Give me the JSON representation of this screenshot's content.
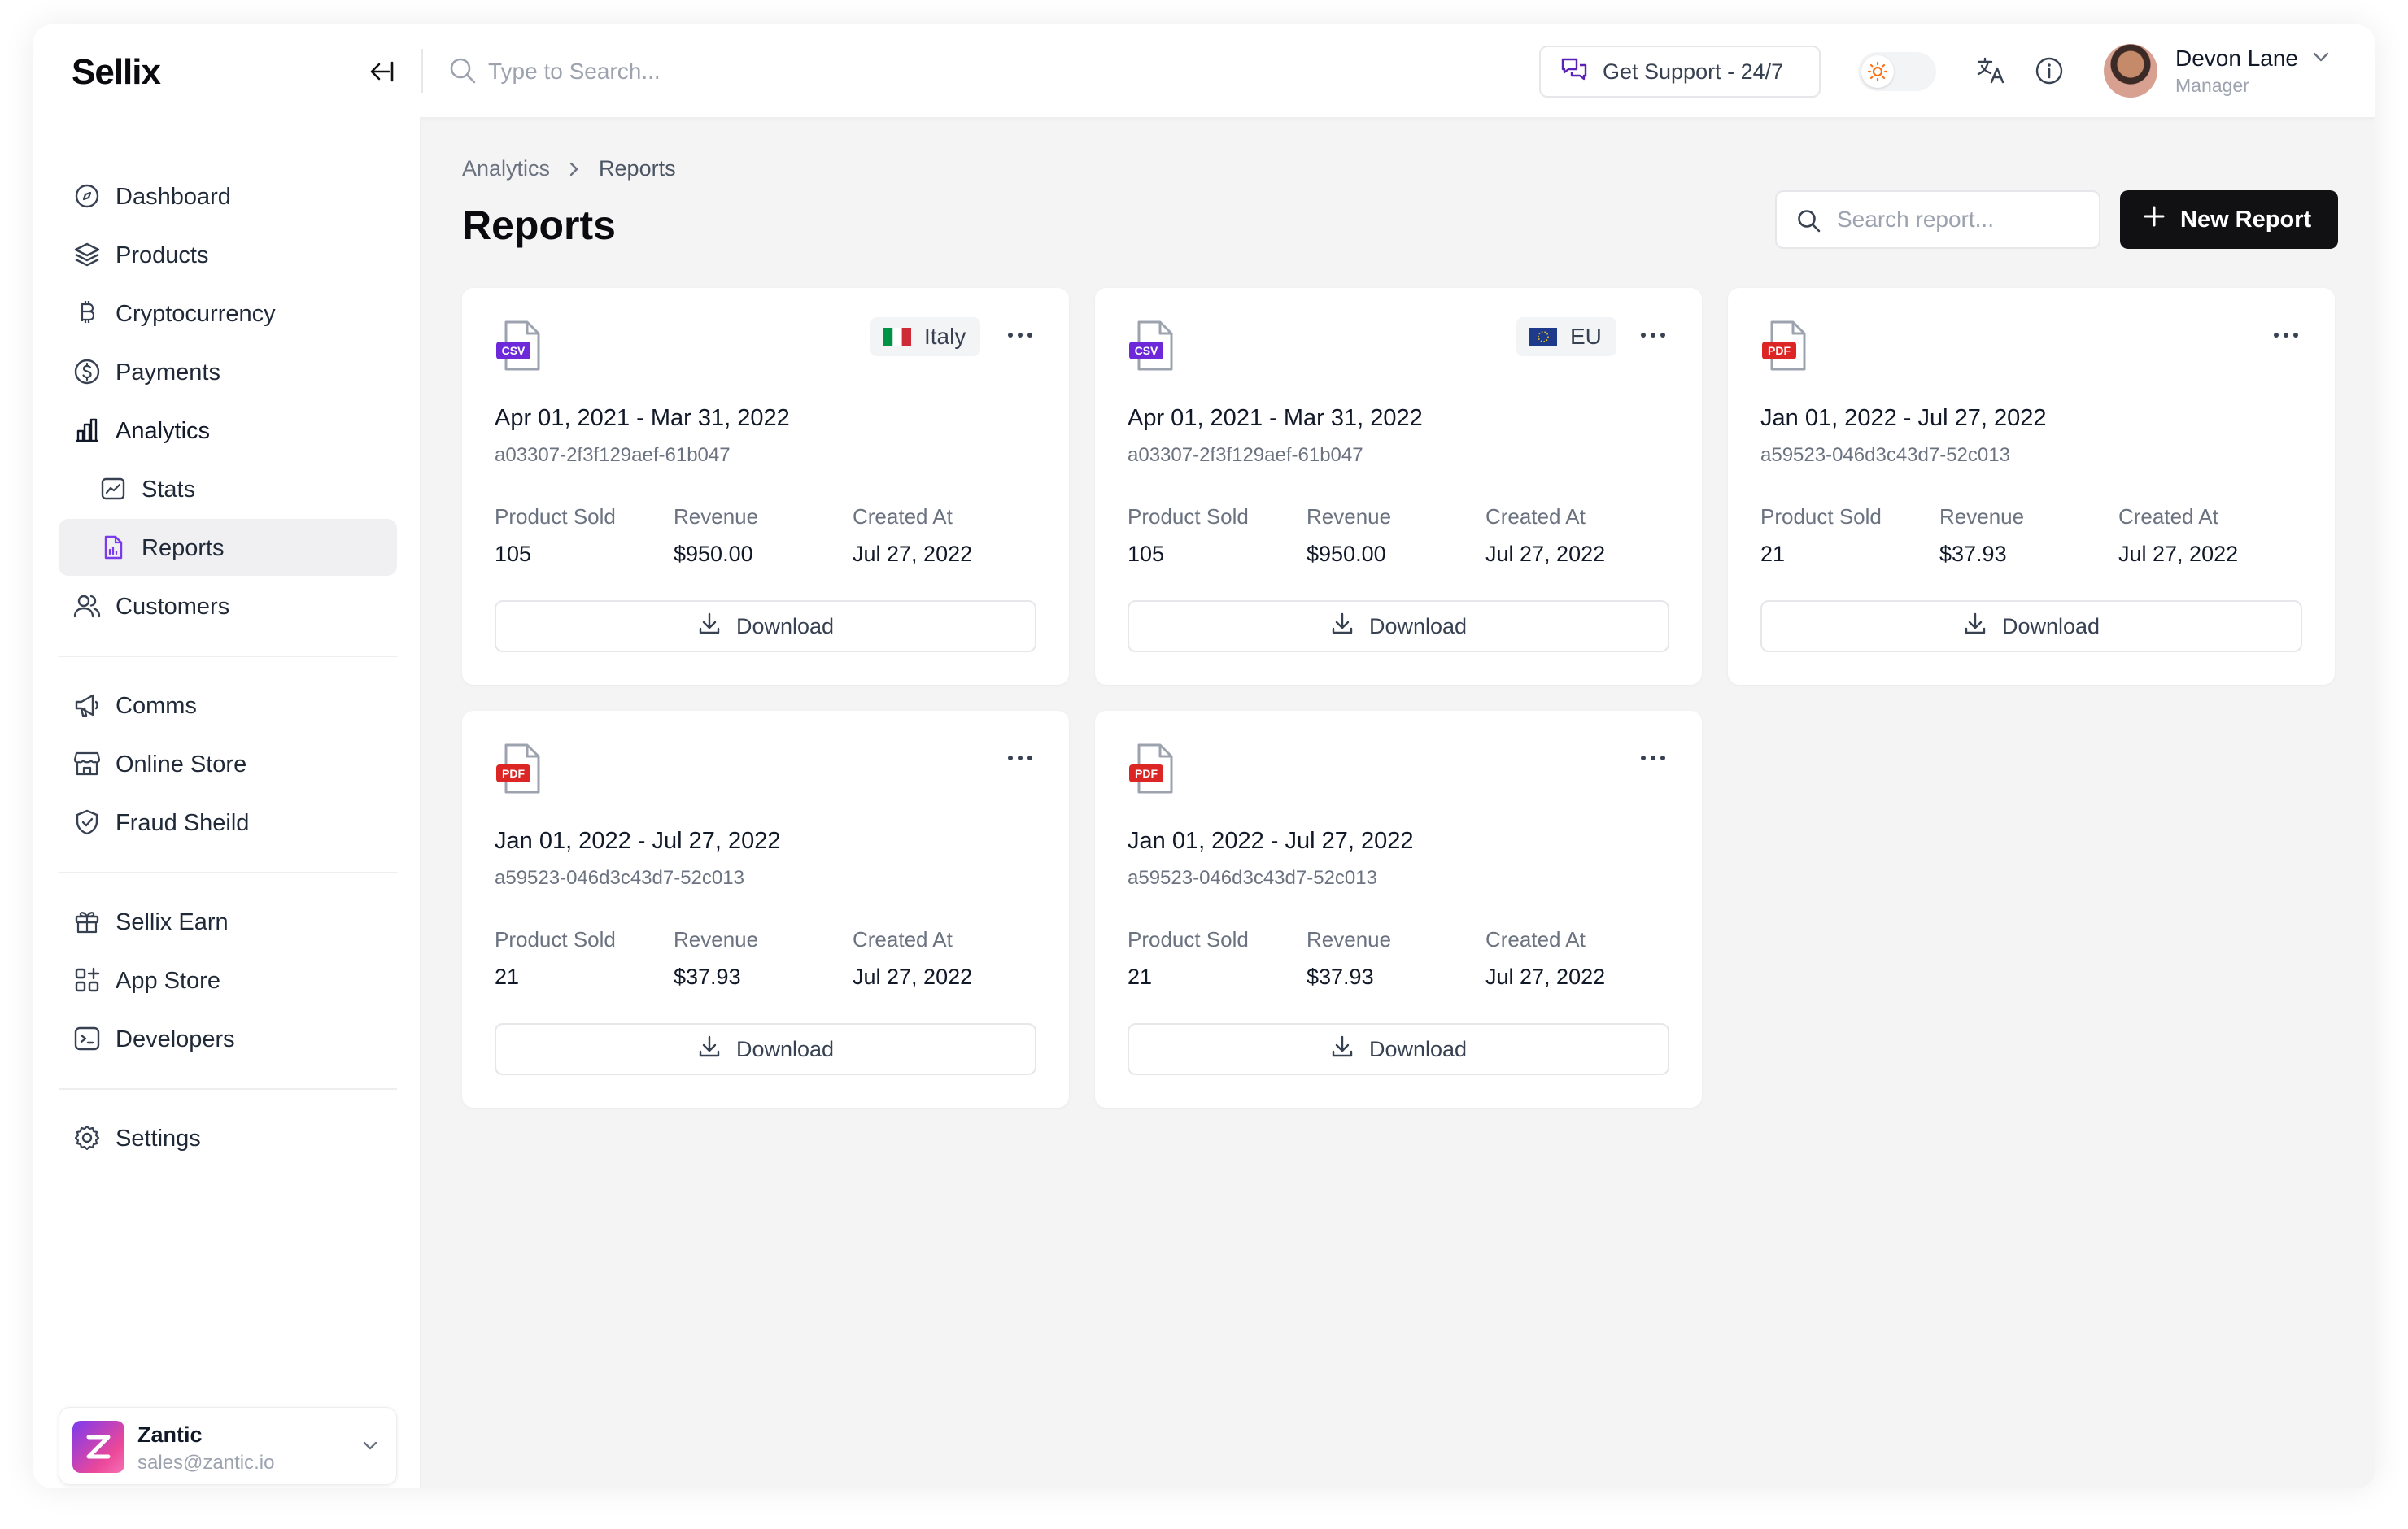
{
  "app": {
    "logo": "Sellix",
    "search_placeholder": "Type to Search...",
    "support_label": "Get Support - 24/7",
    "user": {
      "name": "Devon Lane",
      "role": "Manager"
    }
  },
  "sidebar": {
    "items": [
      {
        "label": "Dashboard",
        "icon": "dashboard-icon"
      },
      {
        "label": "Products",
        "icon": "layers-icon"
      },
      {
        "label": "Cryptocurrency",
        "icon": "bitcoin-icon"
      },
      {
        "label": "Payments",
        "icon": "dollar-circle-icon"
      },
      {
        "label": "Analytics",
        "icon": "bar-chart-icon"
      },
      {
        "label": "Stats",
        "icon": "chart-icon"
      },
      {
        "label": "Reports",
        "icon": "report-file-icon"
      },
      {
        "label": "Customers",
        "icon": "users-icon"
      },
      {
        "label": "Comms",
        "icon": "megaphone-icon"
      },
      {
        "label": "Online Store",
        "icon": "store-icon"
      },
      {
        "label": "Fraud Sheild",
        "icon": "shield-icon"
      },
      {
        "label": "Sellix Earn",
        "icon": "gift-icon"
      },
      {
        "label": "App Store",
        "icon": "apps-icon"
      },
      {
        "label": "Developers",
        "icon": "terminal-icon"
      },
      {
        "label": "Settings",
        "icon": "gear-icon"
      }
    ],
    "org": {
      "name": "Zantic",
      "email": "sales@zantic.io"
    }
  },
  "main": {
    "breadcrumb": [
      "Analytics",
      "Reports"
    ],
    "title": "Reports",
    "search_placeholder": "Search report...",
    "new_report_label": "New Report",
    "stat_labels": {
      "sold": "Product Sold",
      "revenue": "Revenue",
      "created": "Created At"
    },
    "download_label": "Download",
    "reports": [
      {
        "type": "CSV",
        "region": "Italy",
        "range": "Apr 01, 2021 - Mar 31, 2022",
        "id": "a03307-2f3f129aef-61b047",
        "sold": "105",
        "revenue": "$950.00",
        "created": "Jul 27, 2022"
      },
      {
        "type": "CSV",
        "region": "EU",
        "range": "Apr 01, 2021 - Mar 31, 2022",
        "id": "a03307-2f3f129aef-61b047",
        "sold": "105",
        "revenue": "$950.00",
        "created": "Jul 27, 2022"
      },
      {
        "type": "PDF",
        "region": "",
        "range": "Jan 01, 2022 - Jul 27, 2022",
        "id": "a59523-046d3c43d7-52c013",
        "sold": "21",
        "revenue": "$37.93",
        "created": "Jul 27, 2022"
      },
      {
        "type": "PDF",
        "region": "",
        "range": "Jan 01, 2022 - Jul 27, 2022",
        "id": "a59523-046d3c43d7-52c013",
        "sold": "21",
        "revenue": "$37.93",
        "created": "Jul 27, 2022"
      },
      {
        "type": "PDF",
        "region": "",
        "range": "Jan 01, 2022 - Jul 27, 2022",
        "id": "a59523-046d3c43d7-52c013",
        "sold": "21",
        "revenue": "$37.93",
        "created": "Jul 27, 2022"
      }
    ]
  },
  "colors": {
    "csv_badge": "#6d28d9",
    "pdf_badge": "#dc2626",
    "primary_button": "#111113",
    "active_nav_bg": "#f0f0f2"
  }
}
